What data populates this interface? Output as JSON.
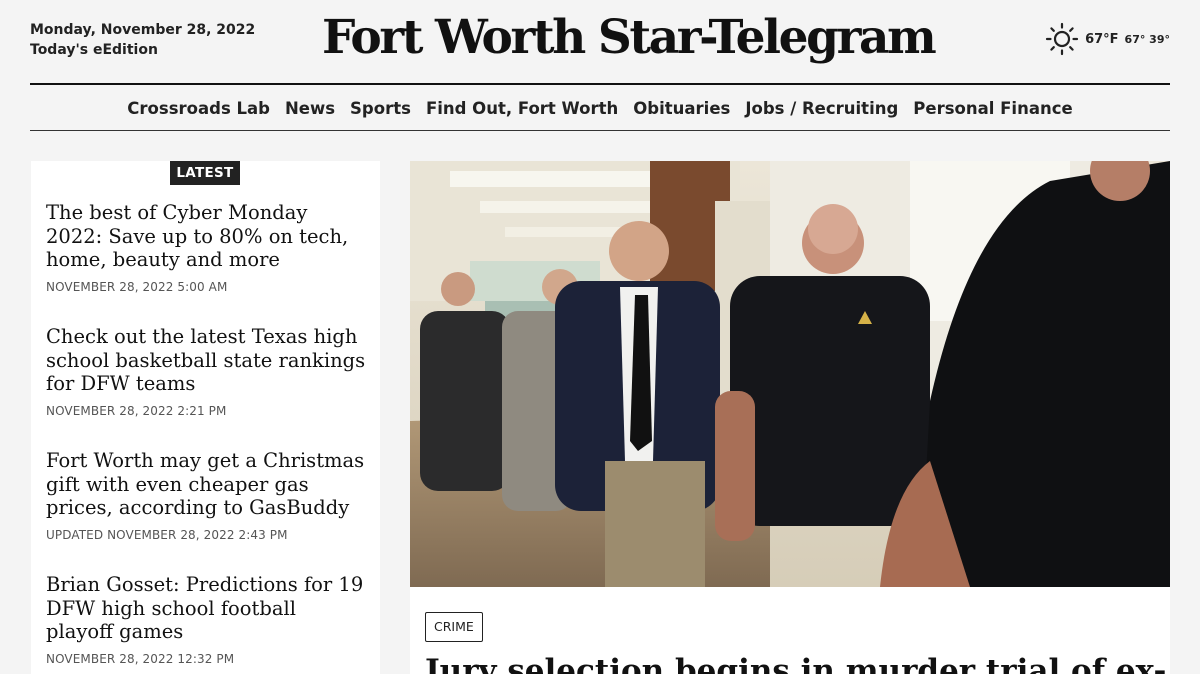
{
  "header": {
    "date": "Monday, November 28, 2022",
    "edition_link": "Today's eEdition",
    "masthead": "Fort Worth Star-Telegram",
    "weather": {
      "icon": "sun-icon",
      "temp": "67°F",
      "range": "67° 39°"
    }
  },
  "nav": {
    "items": [
      "Crossroads Lab",
      "News",
      "Sports",
      "Find Out, Fort Worth",
      "Obituaries",
      "Jobs / Recruiting",
      "Personal Finance"
    ]
  },
  "latest": {
    "badge": "LATEST",
    "stories": [
      {
        "headline": "The best of Cyber Monday 2022: Save up to 80% on tech, home, beauty and more",
        "timestamp": "NOVEMBER 28, 2022 5:00 AM"
      },
      {
        "headline": "Check out the latest Texas high school basketball state rankings for DFW teams",
        "timestamp": "NOVEMBER 28, 2022 2:21 PM"
      },
      {
        "headline": "Fort Worth may get a Christmas gift with even cheaper gas prices, according to GasBuddy",
        "timestamp": "UPDATED NOVEMBER 28, 2022 2:43 PM"
      },
      {
        "headline": "Brian Gosset: Predictions for 19 DFW high school football playoff games",
        "timestamp": "NOVEMBER 28, 2022 12:32 PM"
      }
    ]
  },
  "feature": {
    "tag": "CRIME",
    "headline": "Jury selection begins in murder trial of ex-Fort"
  },
  "colors": {
    "ink": "#111111",
    "page_bg": "#f4f4f4",
    "card_bg": "#ffffff"
  }
}
